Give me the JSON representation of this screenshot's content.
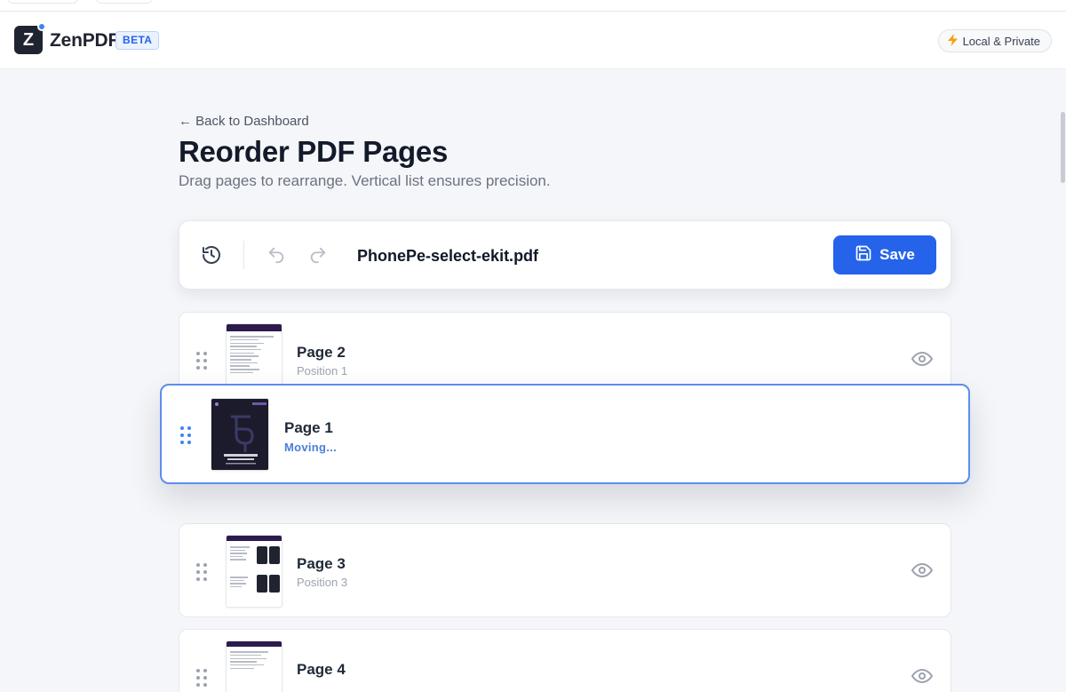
{
  "brand": {
    "logo_letter": "Z",
    "name": "ZenPDF",
    "badge": "BETA"
  },
  "header": {
    "privacy_badge": "Local & Private",
    "privacy_icon": "lightning-bolt-icon"
  },
  "page": {
    "back_link": "← Back to Dashboard",
    "title": "Reorder PDF Pages",
    "subtitle": "Drag pages to rearrange. Vertical list ensures precision."
  },
  "toolbar": {
    "filename": "PhonePe-select-ekit.pdf",
    "save_label": "Save",
    "icons": [
      "history-icon",
      "undo-icon",
      "redo-icon",
      "save-icon"
    ]
  },
  "pages": [
    {
      "title": "Page 2",
      "position": "Position 1"
    },
    {
      "title": "Page 3",
      "position": "Position 3"
    },
    {
      "title": "Page 4",
      "position": ""
    }
  ],
  "dragging": {
    "title": "Page 1",
    "status": "Moving..."
  },
  "colors": {
    "accent": "#2563eb",
    "drag_border": "#5b8def",
    "dark_logo": "#1f2430",
    "bolt": "#f59e0b"
  }
}
